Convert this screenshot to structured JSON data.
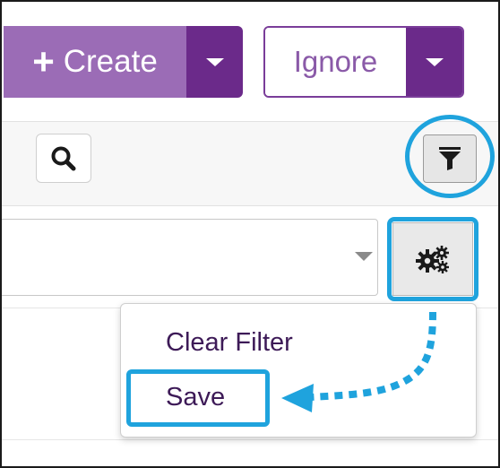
{
  "toolbar": {
    "create_label": "Create",
    "ignore_label": "Ignore"
  },
  "icons": {
    "plus": "plus-icon",
    "caret": "chevron-down-icon",
    "search": "search-icon",
    "filter": "filter-icon",
    "settings": "gears-icon"
  },
  "menu": {
    "items": [
      {
        "label": "Clear Filter"
      },
      {
        "label": "Save"
      }
    ]
  },
  "colors": {
    "brand_purple": "#6b2a8a",
    "create_purple": "#9b6cb6",
    "highlight_blue": "#1fa3dd"
  }
}
